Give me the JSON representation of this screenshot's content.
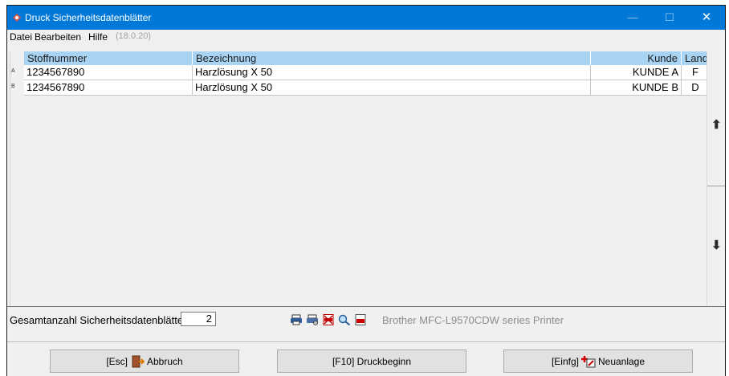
{
  "window": {
    "title": "Druck Sicherheitsdatenblätter",
    "minimize": "—",
    "maximize": "☐",
    "close": "✕"
  },
  "menu": {
    "items": [
      "Datei",
      "Bearbeiten",
      "Hilfe"
    ],
    "version": "(18.0.20)"
  },
  "table": {
    "columns": [
      "Stoffnummer",
      "Bezeichnung",
      "Kunde",
      "Land"
    ],
    "rows": [
      {
        "mark": "A",
        "stoffnummer": "1234567890",
        "bezeichnung": "Harzlösung X 50",
        "kunde": "KUNDE A",
        "land": "F"
      },
      {
        "mark": "B",
        "stoffnummer": "1234567890",
        "bezeichnung": "Harzlösung X 50",
        "kunde": "KUNDE B",
        "land": "D"
      }
    ]
  },
  "scroll": {
    "up": "⬆",
    "down": "⬇"
  },
  "footer": {
    "total_label": "Gesamtanzahl Sicherheitsdatenblätter",
    "total_value": "2",
    "printer_name": "Brother MFC-L9570CDW series Printer",
    "icons": [
      "printer-icon",
      "printer-settings-icon",
      "pdf-cancel-icon",
      "print-preview-icon",
      "pdf-icon"
    ]
  },
  "buttons": {
    "esc_key": "[Esc]",
    "esc_label": "Abbruch",
    "f10_label": "[F10] Druckbeginn",
    "einfg_key": "[Einfg]",
    "einfg_label": "Neuanlage"
  },
  "colors": {
    "titlebar": "#0078d7",
    "header": "#a8d3f3"
  }
}
